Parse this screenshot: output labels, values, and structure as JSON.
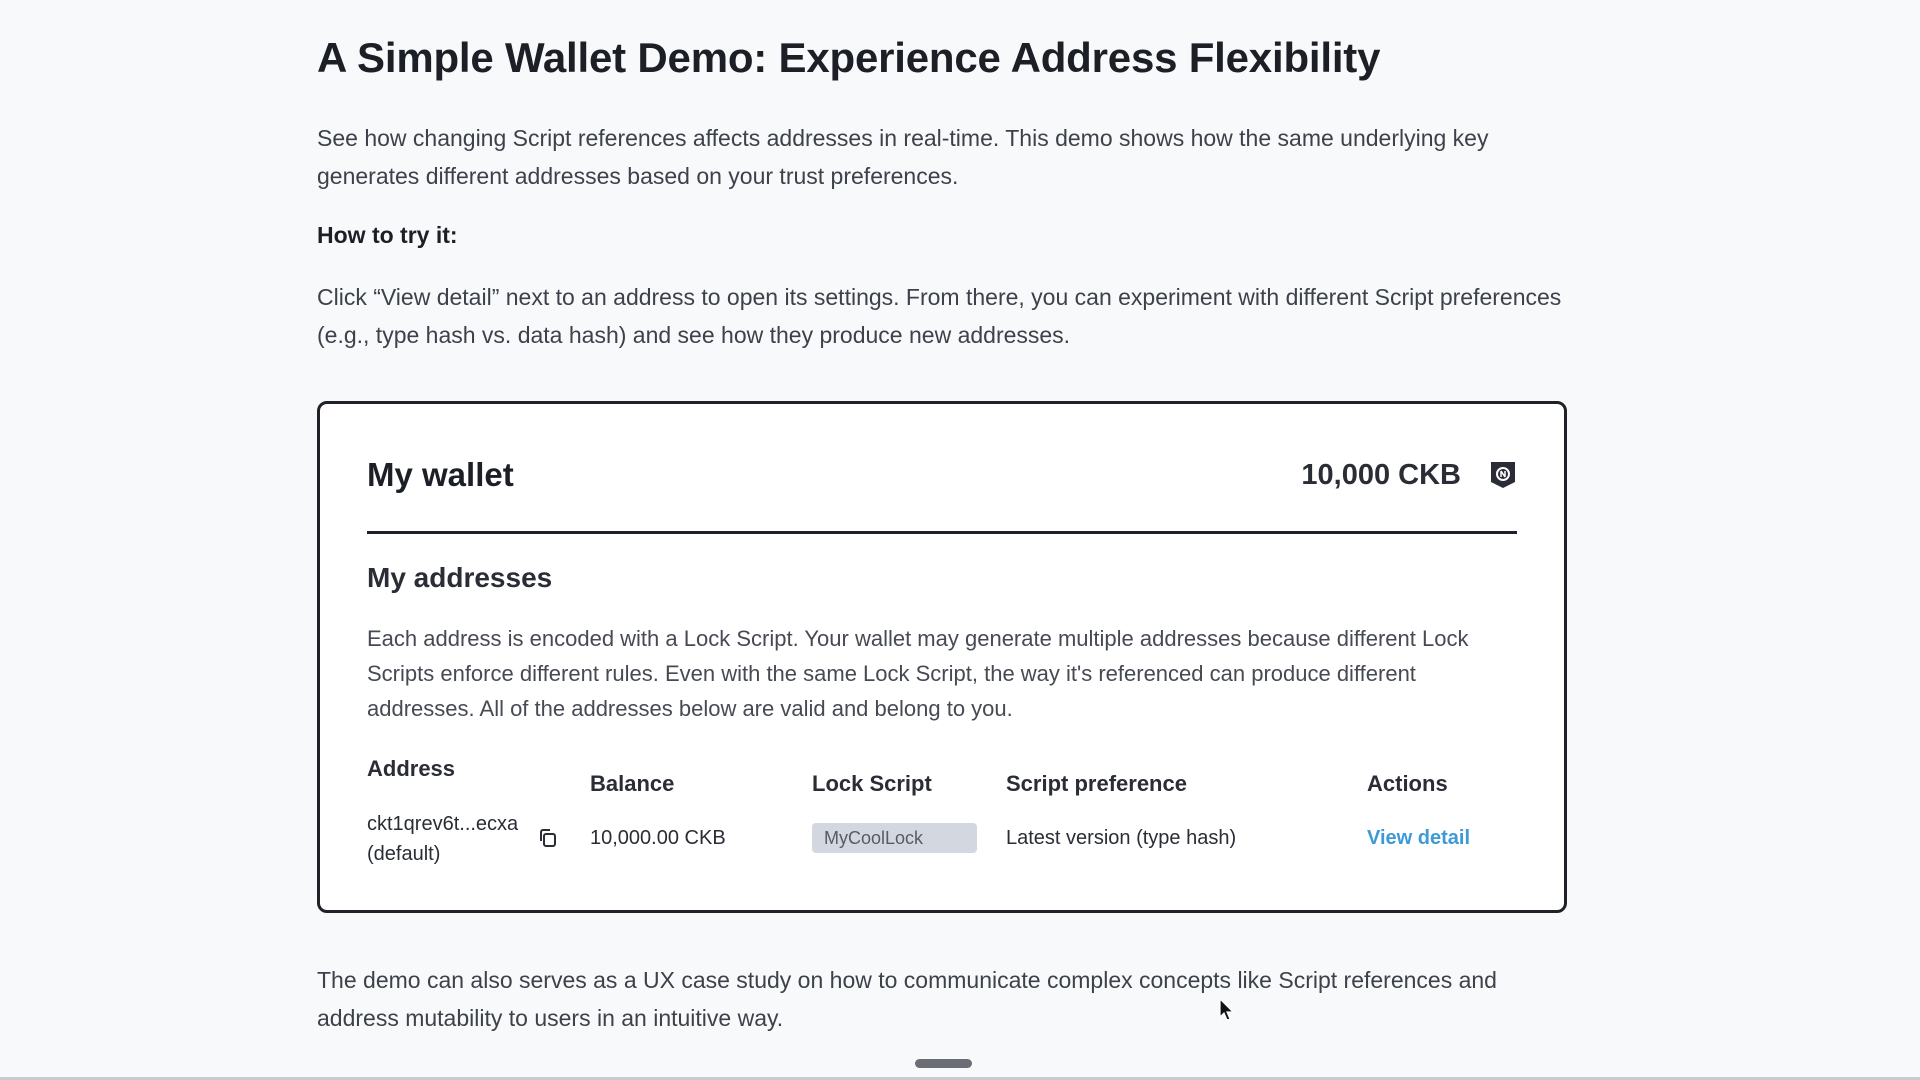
{
  "page": {
    "title": "A Simple Wallet Demo: Experience Address Flexibility",
    "intro": "See how changing Script references affects addresses in real-time. This demo shows how the same underlying key generates different addresses based on your trust preferences.",
    "howto_heading": "How to try it:",
    "instructions": "Click “View detail” next to an address to open its settings. From there, you can experiment with different Script preferences (e.g., type hash vs. data hash) and see how they produce new addresses.",
    "footer": "The demo can also serves as a UX case study on how to communicate complex concepts like Script references and address mutability to users in an intuitive way."
  },
  "wallet": {
    "title": "My wallet",
    "balance": "10,000 CKB",
    "balance_icon": "ckb-token-icon",
    "addresses_title": "My addresses",
    "addresses_description": "Each address is encoded with a Lock Script. Your wallet may generate multiple addresses because different Lock Scripts enforce different rules. Even with the same Lock Script, the way it's referenced can produce different addresses. All of the addresses below are valid and belong to you.",
    "table": {
      "headers": {
        "address": "Address",
        "balance": "Balance",
        "lock_script": "Lock Script",
        "script_preference": "Script preference",
        "actions": "Actions"
      },
      "rows": [
        {
          "address": "ckt1qrev6t...ecxa",
          "address_note": "(default)",
          "copy_icon": "copy-icon",
          "balance": "10,000.00 CKB",
          "lock_script": "MyCoolLock",
          "script_preference": "Latest version (type hash)",
          "action": "View detail"
        }
      ]
    }
  },
  "colors": {
    "background": "#f8f9fb",
    "card_border": "#1f2228",
    "link": "#3d9ad6",
    "badge_bg": "#d3d7e0"
  }
}
